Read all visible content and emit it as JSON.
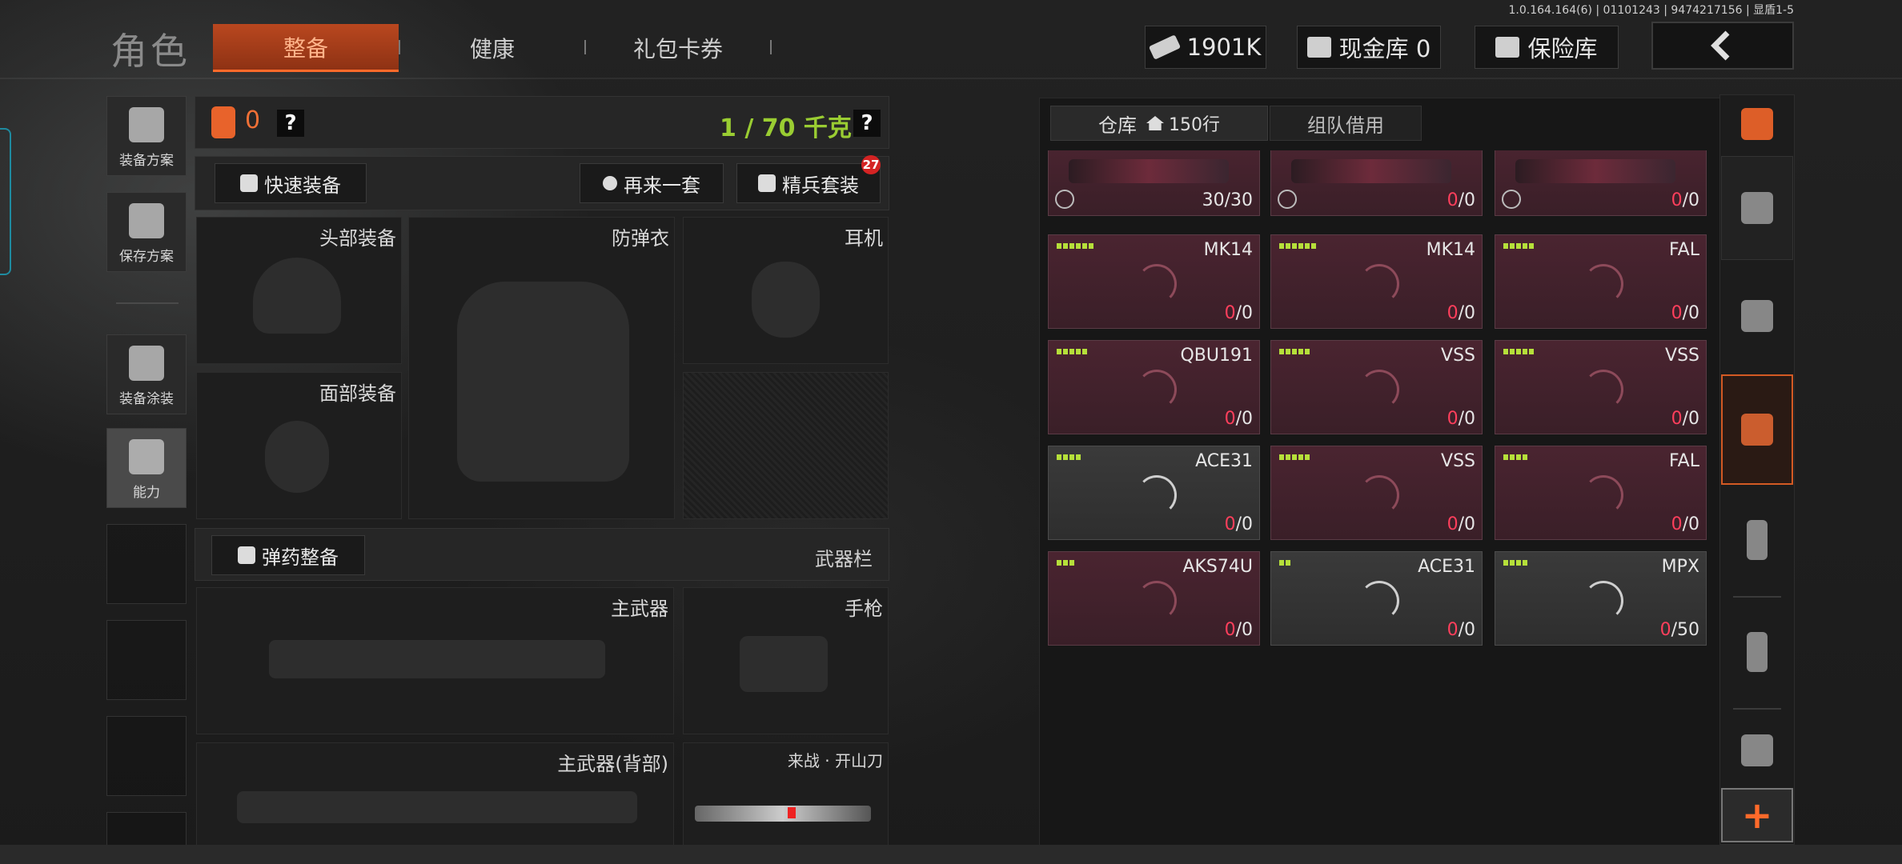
{
  "version_text": "1.0.164.164(6) | 01101243 | 9474217156 | 显盾1-5",
  "header": {
    "title": "角色",
    "tabs": [
      {
        "label": "整备",
        "active": true
      },
      {
        "label": "健康",
        "active": false
      },
      {
        "label": "礼包卡券",
        "active": false
      }
    ],
    "currency": {
      "value": "1901K",
      "icon": "banknote-icon"
    },
    "cash_vault": {
      "label": "现金库 0",
      "icon": "vault-icon"
    },
    "safe_vault": {
      "label": "保险库",
      "icon": "safe-box-icon"
    },
    "back_icon": "chevron-left-icon"
  },
  "left_rail": {
    "items": [
      {
        "label": "装备方案",
        "icon": "vest-icon"
      },
      {
        "label": "保存方案",
        "icon": "download-icon"
      },
      {
        "label": "装备涂装",
        "icon": "helmet-paint-icon"
      },
      {
        "label": "能力",
        "icon": "lightning-hex-icon"
      }
    ]
  },
  "equipment": {
    "bag_count": "0",
    "weight": "1 / 70 千克",
    "help": "?",
    "quick_equip": "快速装备",
    "another_set": "再来一套",
    "elite_set": "精兵套装",
    "elite_badge": "27",
    "slots": {
      "head": "头部装备",
      "armor": "防弹衣",
      "earphone": "耳机",
      "face": "面部装备",
      "primary": "主武器",
      "pistol": "手枪",
      "primary_back": "主武器(背部)",
      "melee": "来战 · 开山刀"
    },
    "ammo_prep": "弹药整备",
    "weapon_bar": "武器栏"
  },
  "warehouse": {
    "tab_storage": "仓库",
    "tab_storage_rows": "150行",
    "tab_team": "组队借用",
    "cards": [
      {
        "name": "",
        "count_lo": "",
        "count": "30/30",
        "bars": 0,
        "style": "red",
        "image": true
      },
      {
        "name": "",
        "count_lo": "0",
        "count": "/0",
        "bars": 0,
        "style": "red",
        "image": true
      },
      {
        "name": "",
        "count_lo": "0",
        "count": "/0",
        "bars": 0,
        "style": "red",
        "image": true
      },
      {
        "name": "MK14",
        "count_lo": "0",
        "count": "/0",
        "bars": 6,
        "style": "red"
      },
      {
        "name": "MK14",
        "count_lo": "0",
        "count": "/0",
        "bars": 6,
        "style": "red"
      },
      {
        "name": "FAL",
        "count_lo": "0",
        "count": "/0",
        "bars": 5,
        "style": "red"
      },
      {
        "name": "QBU191",
        "count_lo": "0",
        "count": "/0",
        "bars": 5,
        "style": "red"
      },
      {
        "name": "VSS",
        "count_lo": "0",
        "count": "/0",
        "bars": 5,
        "style": "red"
      },
      {
        "name": "VSS",
        "count_lo": "0",
        "count": "/0",
        "bars": 5,
        "style": "red"
      },
      {
        "name": "ACE31",
        "count_lo": "0",
        "count": "/0",
        "bars": 4,
        "style": "grey"
      },
      {
        "name": "VSS",
        "count_lo": "0",
        "count": "/0",
        "bars": 5,
        "style": "red"
      },
      {
        "name": "FAL",
        "count_lo": "0",
        "count": "/0",
        "bars": 4,
        "style": "red"
      },
      {
        "name": "AKS74U",
        "count_lo": "0",
        "count": "/0",
        "bars": 3,
        "style": "red"
      },
      {
        "name": "ACE31",
        "count_lo": "0",
        "count": "/0",
        "bars": 2,
        "style": "grey"
      },
      {
        "name": "MPX",
        "count_lo": "0",
        "count": "/50",
        "bars": 4,
        "style": "grey"
      }
    ]
  },
  "category_rail": {
    "items": [
      {
        "icon": "stack-refresh-icon"
      },
      {
        "icon": "home-icon"
      },
      {
        "icon": "helmet-icon"
      },
      {
        "icon": "rifle-icon",
        "active": true
      },
      {
        "icon": "magazine-icon"
      },
      {
        "icon": "bullet-icon"
      },
      {
        "icon": "scope-icon"
      }
    ],
    "add_label": "+"
  }
}
